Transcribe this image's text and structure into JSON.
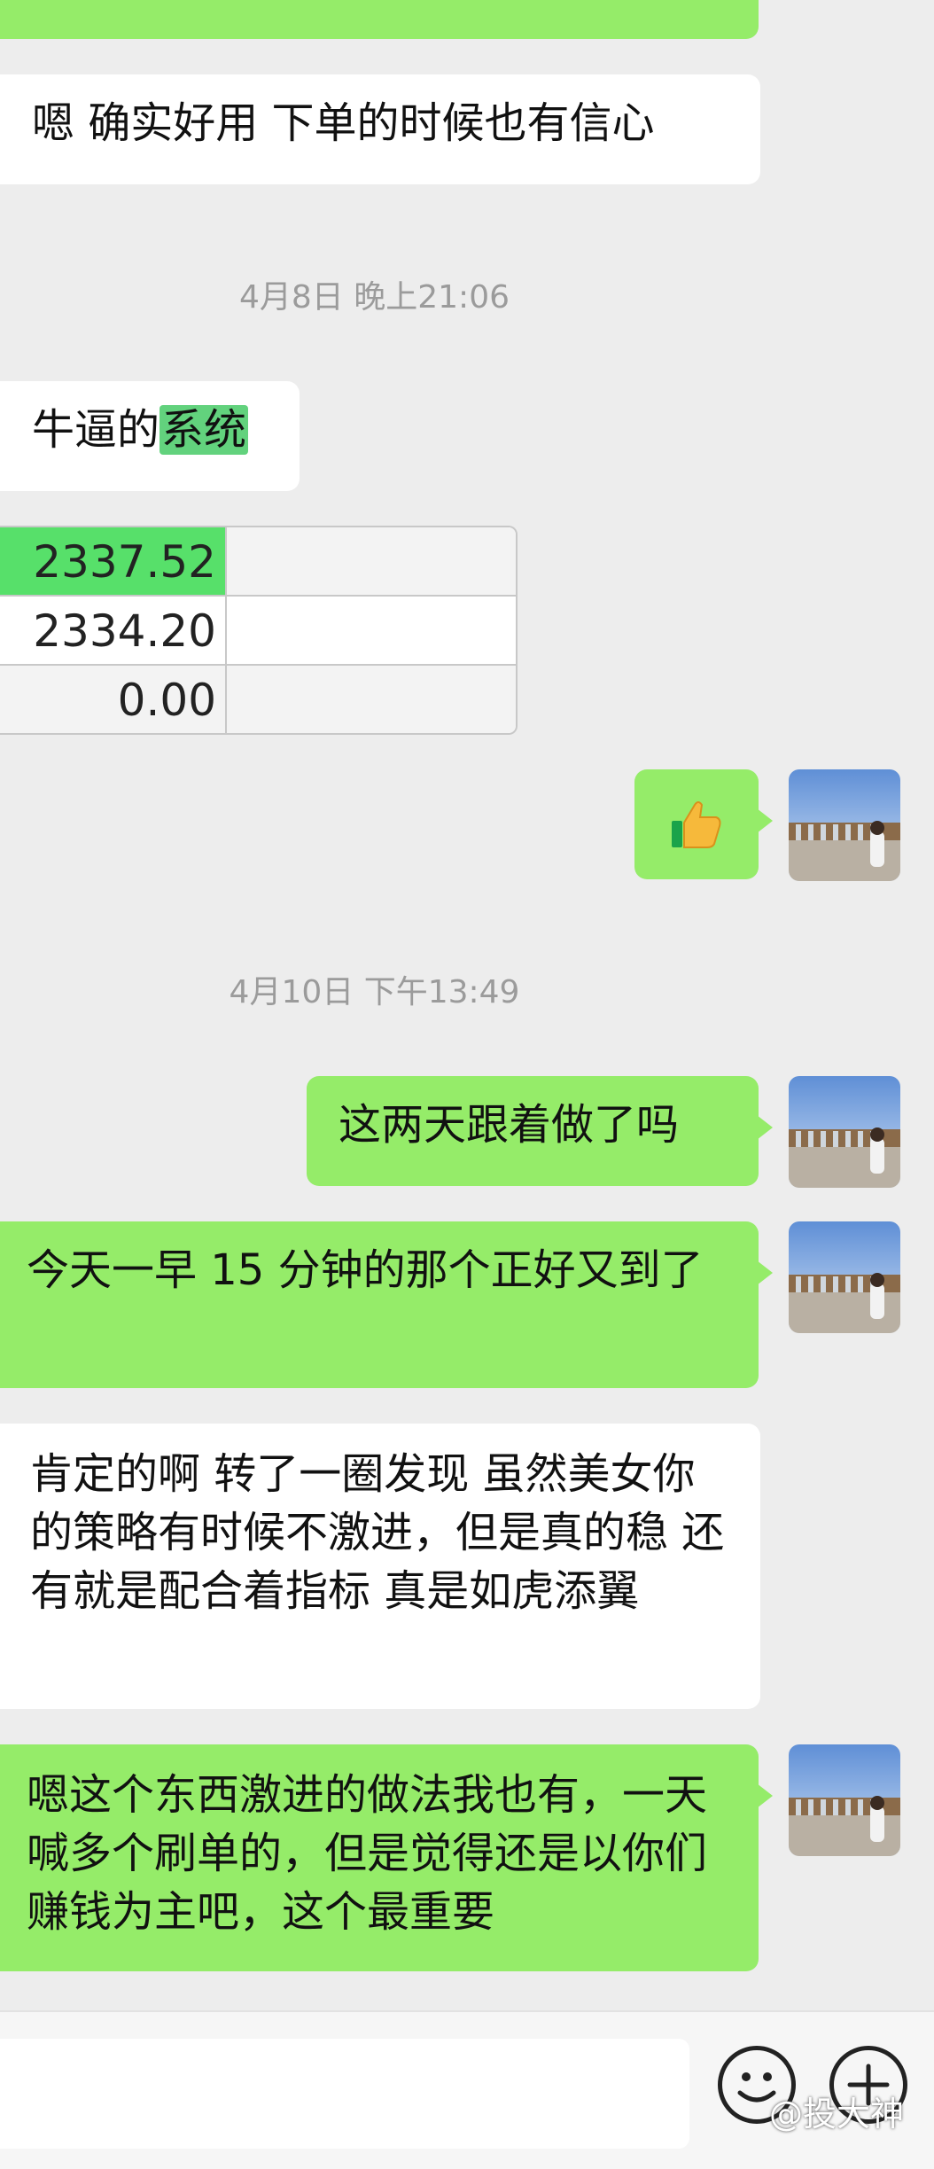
{
  "messages": {
    "m1": "嗯  确实好用  下单的时候也有信心",
    "ts1": "4月8日 晚上21:06",
    "m2_a": "牛逼的",
    "m2_b": "系统",
    "table": [
      "2337.52",
      "2334.20",
      "0.00"
    ],
    "ts2": "4月10日 下午13:49",
    "m4": "这两天跟着做了吗",
    "m5": "今天一早 15 分钟的那个正好又到了",
    "m6": "肯定的啊 转了一圈发现 虽然美女你的策略有时候不激进，但是真的稳 还有就是配合着指标 真是如虎添翼",
    "m7": "嗯这个东西激进的做法我也有，一天喊多个刷单的，但是觉得还是以你们赚钱为主吧，这个最重要"
  },
  "watermark": "@投大神",
  "colors": {
    "green_bubble": "#95ec69",
    "background": "#ededed"
  },
  "icons": [
    "thumbs-up-icon",
    "emoji-icon",
    "plus-icon"
  ]
}
